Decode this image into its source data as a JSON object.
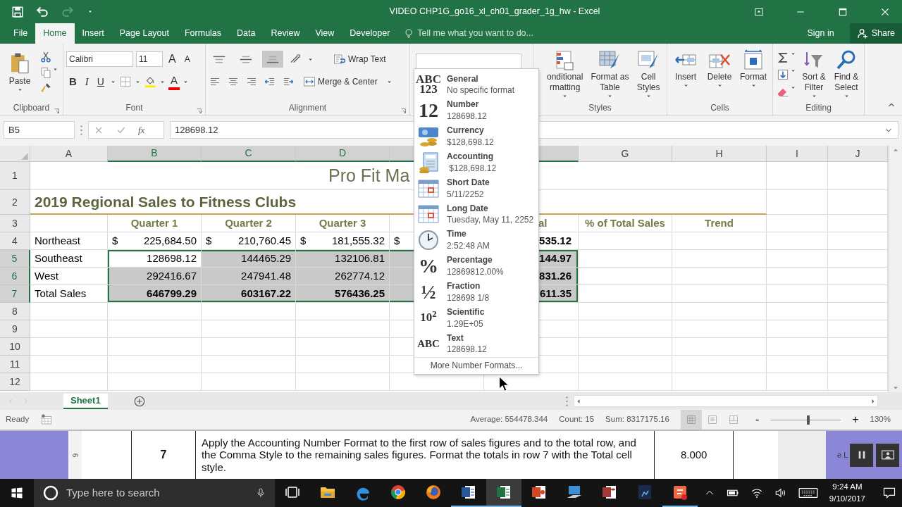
{
  "title_bar": {
    "title": "VIDEO CHP1G_go16_xl_ch01_grader_1g_hw - Excel",
    "redo_disabled": true
  },
  "tabs": [
    {
      "label": "File",
      "selected": false
    },
    {
      "label": "Home",
      "selected": true
    },
    {
      "label": "Insert",
      "selected": false
    },
    {
      "label": "Page Layout",
      "selected": false
    },
    {
      "label": "Formulas",
      "selected": false
    },
    {
      "label": "Data",
      "selected": false
    },
    {
      "label": "Review",
      "selected": false
    },
    {
      "label": "View",
      "selected": false
    },
    {
      "label": "Developer",
      "selected": false
    }
  ],
  "tell_me": {
    "placeholder": "Tell me what you want to do..."
  },
  "account": {
    "sign_in": "Sign in",
    "share": "Share"
  },
  "ribbon": {
    "clipboard": {
      "label": "Clipboard",
      "paste": "Paste"
    },
    "font": {
      "label": "Font",
      "font_name": "Calibri",
      "font_size": "11",
      "grow": "A",
      "shrink": "A",
      "bold": "B",
      "italic": "I",
      "underline": "U",
      "font_color": "A"
    },
    "alignment": {
      "label": "Alignment",
      "vertical": [
        {
          "selected": false
        },
        {
          "selected": false
        },
        {
          "selected": true
        }
      ],
      "wrap_text": "Wrap Text",
      "merge_center": "Merge & Center"
    },
    "styles": {
      "label": "Styles",
      "buttons": [
        {
          "kind": "conditional",
          "label": "onditional\nrmatting"
        },
        {
          "kind": "table",
          "label": "Format as\nTable"
        },
        {
          "kind": "cellstyles",
          "label": "Cell\nStyles"
        }
      ]
    },
    "cells": {
      "label": "Cells",
      "buttons": [
        {
          "kind": "insert",
          "label": "Insert"
        },
        {
          "kind": "delete",
          "label": "Delete"
        },
        {
          "kind": "format",
          "label": "Format"
        }
      ]
    },
    "editing": {
      "label": "Editing",
      "buttons": [
        {
          "kind": "sort",
          "label": "Sort &\nFilter"
        },
        {
          "kind": "find",
          "label": "Find &\nSelect"
        }
      ]
    }
  },
  "formula_bar": {
    "name_box": "B5",
    "fx": "fx",
    "value": "128698.12"
  },
  "sheet": {
    "columns": [
      {
        "letter": "A",
        "selected": false
      },
      {
        "letter": "B",
        "selected": true
      },
      {
        "letter": "C",
        "selected": true
      },
      {
        "letter": "D",
        "selected": true
      },
      {
        "selected": true
      },
      {
        "selected": true
      },
      {
        "letter": "G",
        "selected": false
      },
      {
        "letter": "H",
        "selected": false
      },
      {
        "letter": "I",
        "selected": false
      },
      {
        "letter": "J",
        "selected": false
      }
    ],
    "rows": [
      {
        "number": "1",
        "kind": "title",
        "selected": false,
        "text": "Pro Fit Ma"
      },
      {
        "number": "2",
        "kind": "subtitle",
        "selected": false,
        "text": "2019 Regional Sales to Fitness Clubs"
      },
      {
        "number": "3",
        "kind": "header",
        "selected": false,
        "cells": {
          "B": "Quarter 1",
          "C": "Quarter 2",
          "D": "Quarter 3",
          "F": "al",
          "G": "% of Total Sales",
          "H": "Trend"
        }
      },
      {
        "number": "4",
        "kind": "data",
        "selected": false,
        "cells": {
          "A": "Northeast",
          "B": {
            "currency": "$",
            "amount": "225,684.50"
          },
          "C": {
            "currency": "$",
            "amount": "210,760.45"
          },
          "D": {
            "currency": "$",
            "amount": "181,555.32"
          },
          "E": {
            "currency": "$"
          },
          "F": "535.12"
        }
      },
      {
        "number": "5",
        "kind": "data",
        "selected": true,
        "cells": {
          "A": "Southeast",
          "B": {
            "text": "128698.12",
            "active": true
          },
          "C": "144465.29",
          "D": "132106.81",
          "F": "144.97"
        }
      },
      {
        "number": "6",
        "kind": "data",
        "selected": true,
        "cells": {
          "A": "West",
          "B": "292416.67",
          "C": "247941.48",
          "D": "262774.12",
          "F": "831.26"
        }
      },
      {
        "number": "7",
        "kind": "total",
        "selected": true,
        "cells": {
          "A": "Total Sales",
          "B": "646799.29",
          "C": "603167.22",
          "D": "576436.25",
          "F": "611.35"
        }
      },
      {
        "number": "8",
        "kind": "data",
        "selected": false
      },
      {
        "number": "9",
        "kind": "data",
        "selected": false
      },
      {
        "number": "10",
        "kind": "data",
        "selected": false
      },
      {
        "number": "11",
        "kind": "data",
        "selected": false
      },
      {
        "number": "12",
        "kind": "data",
        "selected": false
      }
    ]
  },
  "number_formats": {
    "items": [
      {
        "kind": "glyph",
        "glyph": "ABC\n123",
        "name": "General",
        "example": "No specific format"
      },
      {
        "kind": "glyph",
        "glyph": "12",
        "name": "Number",
        "example": "128698.12"
      },
      {
        "kind": "currency",
        "name": "Currency",
        "example": "$128,698.12"
      },
      {
        "kind": "accounting",
        "name": "Accounting",
        "example": " $128,698.12"
      },
      {
        "kind": "calendar",
        "name": "Short Date",
        "example": "5/11/2252"
      },
      {
        "kind": "calendar",
        "name": "Long Date",
        "example": "Tuesday, May 11, 2252"
      },
      {
        "kind": "clock",
        "name": "Time",
        "example": "2:52:48 AM"
      },
      {
        "kind": "glyph",
        "glyph": "%",
        "name": "Percentage",
        "example": "12869812.00%"
      },
      {
        "kind": "glyph",
        "glyph": "½",
        "name": "Fraction",
        "example": "128698 1/8"
      },
      {
        "kind": "glyph",
        "glyph": "10$^{2}$",
        "name": "Scientific",
        "example": "1.29E+05"
      },
      {
        "kind": "glyph",
        "glyph": "ABC",
        "name": "Text",
        "example": "128698.12"
      }
    ],
    "more": "More Number Formats..."
  },
  "sheet_tabs": [
    {
      "label": "Sheet1",
      "selected": true
    }
  ],
  "status_bar": {
    "ready": "Ready",
    "average": "Average: 554478.344",
    "count": "Count: 15",
    "sum": "Sum: 8317175.16",
    "views": [
      {
        "kind": "normal",
        "selected": true
      },
      {
        "kind": "page_layout",
        "selected": false
      },
      {
        "kind": "page_break",
        "selected": false
      }
    ],
    "zoom": {
      "minus": "-",
      "plus": "+",
      "level": 0.54,
      "reading": "130%"
    }
  },
  "document": {
    "ruler_mark": "6",
    "step": "7",
    "instruction": "Apply the Accounting Number Format to the first row of sales figures and to the total row, and the Comma Style to the remaining sales figures. Format the totals in row 7 with the Total cell style.",
    "points": "8.000",
    "side_text": "e L"
  },
  "taskbar": {
    "search": {
      "placeholder": "Type here to search"
    },
    "apps": [
      {
        "kind": "taskview",
        "running": false,
        "active": false
      },
      {
        "kind": "folder",
        "running": false,
        "active": false
      },
      {
        "kind": "edge",
        "running": false,
        "active": false
      },
      {
        "kind": "chrome",
        "running": false,
        "active": false
      },
      {
        "kind": "firefox",
        "running": false,
        "active": false
      },
      {
        "kind": "word",
        "running": true,
        "active": false
      },
      {
        "kind": "excel",
        "running": true,
        "active": true
      },
      {
        "kind": "powerpoint",
        "running": false,
        "active": false
      },
      {
        "kind": "remote",
        "running": false,
        "active": false
      },
      {
        "kind": "access",
        "running": false,
        "active": false
      },
      {
        "kind": "kindle",
        "running": false,
        "active": false
      },
      {
        "kind": "snagit",
        "running": true,
        "active": false
      }
    ],
    "clock": {
      "time": "9:24 AM",
      "date": "9/10/2017"
    }
  }
}
